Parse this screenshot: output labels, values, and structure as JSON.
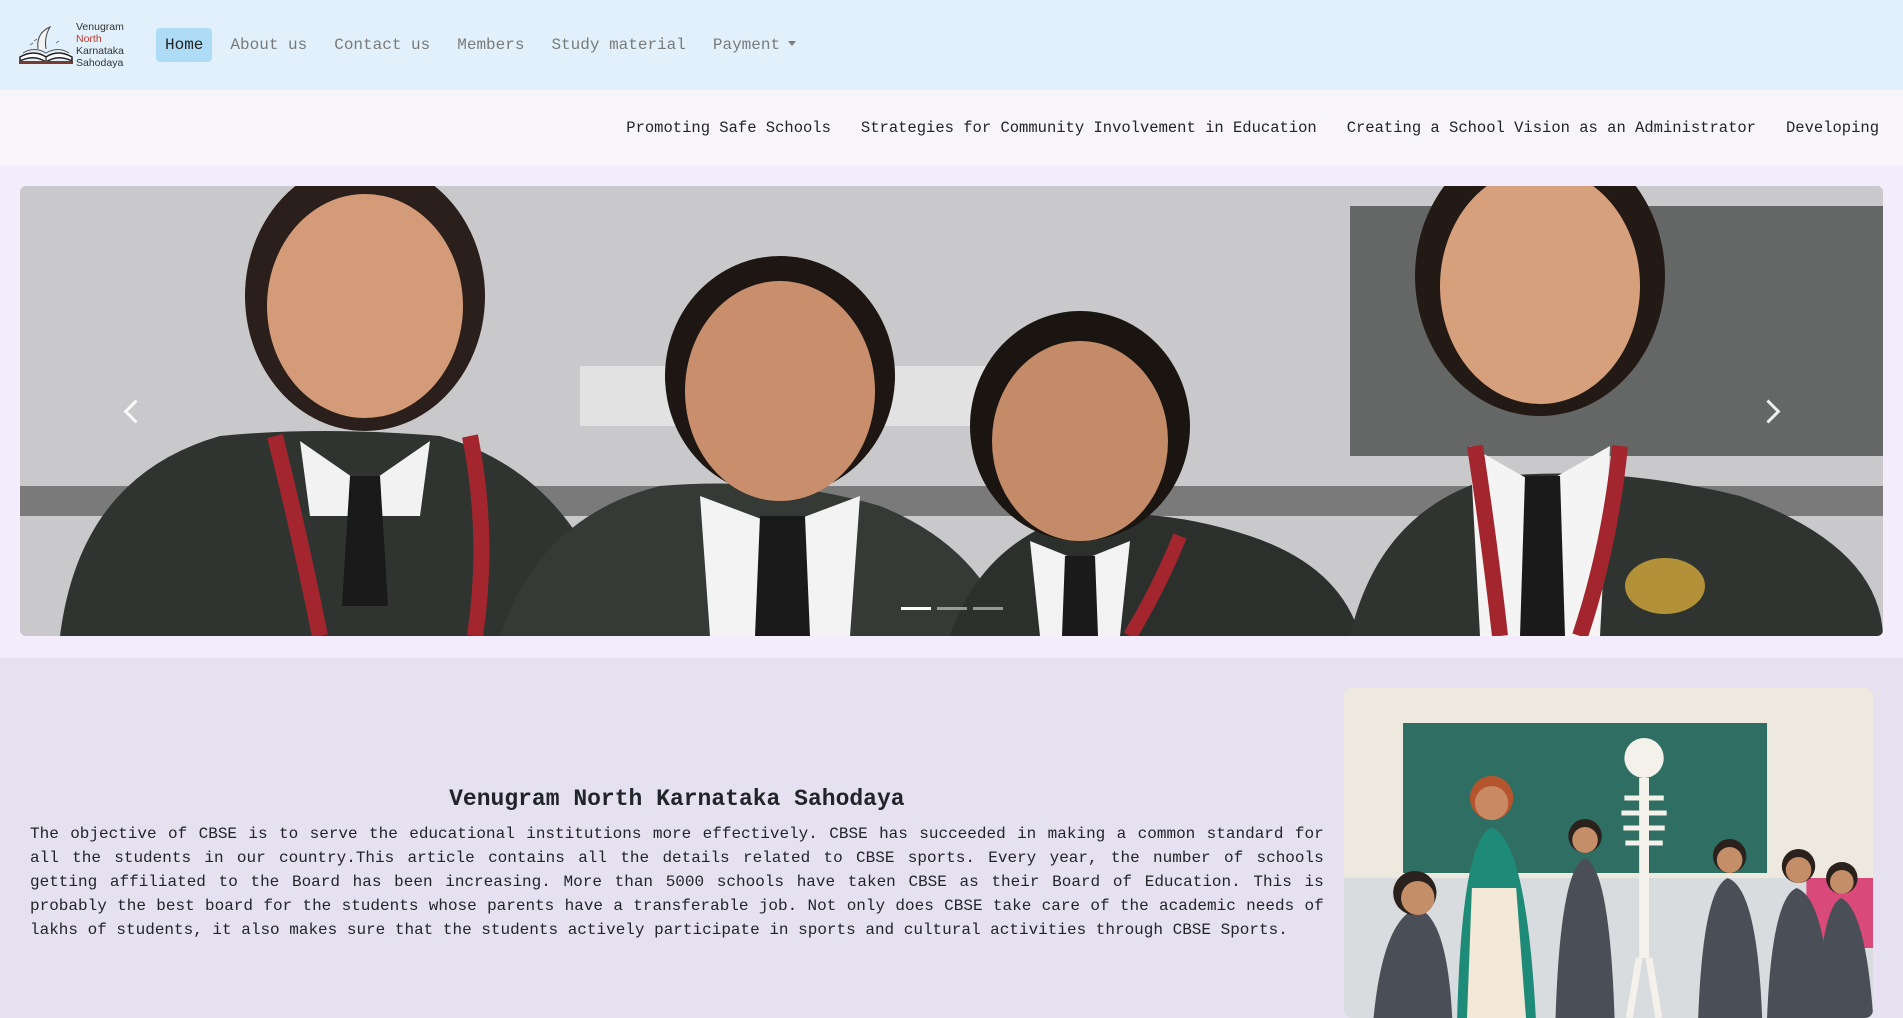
{
  "brand": {
    "logo_lines": [
      "Venugram",
      "North",
      "Karnataka",
      "Sahodaya"
    ]
  },
  "topnav": {
    "items": [
      {
        "label": "Home",
        "active": true
      },
      {
        "label": "About us"
      },
      {
        "label": "Contact us"
      },
      {
        "label": "Members"
      },
      {
        "label": "Study material"
      },
      {
        "label": "Payment",
        "dropdown": true
      }
    ]
  },
  "subnav": {
    "items": [
      {
        "label": "Promoting Safe Schools"
      },
      {
        "label": "Strategies for Community Involvement in Education"
      },
      {
        "label": "Creating a School Vision as an Administrator"
      },
      {
        "label": "Developing"
      }
    ]
  },
  "carousel": {
    "slide_count": 3,
    "active_index": 0,
    "image": "students-in-uniform-photo"
  },
  "main": {
    "title": "Venugram North Karnataka Sahodaya",
    "paragraph": "The objective of CBSE is to serve the educational institutions more effectively. CBSE has succeeded in making a common standard for all the students in our country.This article contains all the details related to CBSE sports. Every year, the number of schools getting affiliated to the Board has been increasing. More than 5000 schools have taken CBSE as their Board of Education. This is probably the best board for the students whose parents have a transferable job. Not only does CBSE take care of the academic needs of lakhs of students, it also makes sure that the students actively participate in sports and cultural activities through CBSE Sports.",
    "side_image": "classroom-skeleton-photo"
  },
  "colors": {
    "topnav_bg": "#e1f0fb",
    "active_nav_bg": "#aedcf7",
    "subnav_bg": "#f7f5f7",
    "carousel_band_bg": "#f3ecfc",
    "page_bg": "#e6e1f1"
  }
}
